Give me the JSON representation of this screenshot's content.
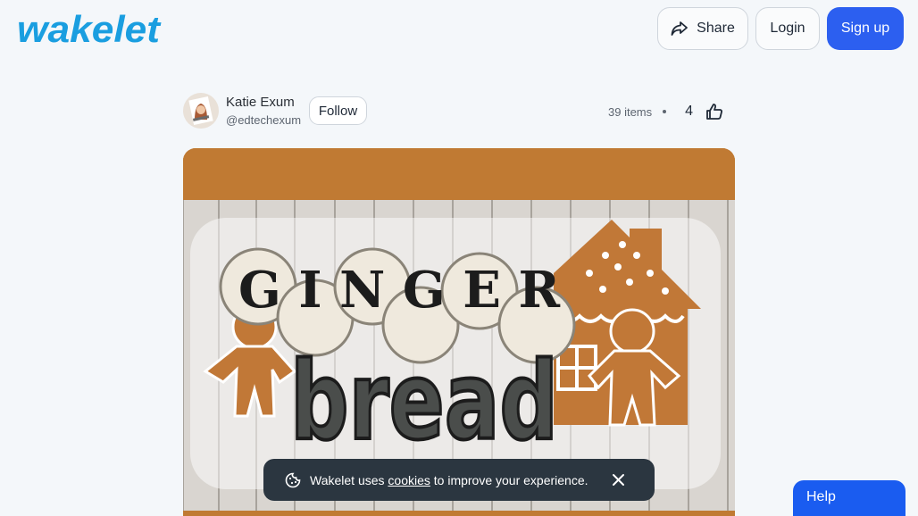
{
  "header": {
    "logo_text": "wakelet",
    "share_label": "Share",
    "login_label": "Login",
    "signup_label": "Sign up"
  },
  "profile": {
    "name": "Katie Exum",
    "handle": "@edtechexum",
    "follow_label": "Follow"
  },
  "stats": {
    "items": "39 items",
    "likes": "4"
  },
  "cover": {
    "title_top": "GINGER",
    "title_bottom": "bread",
    "colors": {
      "band": "#c07a33",
      "gingerbread": "#c17837"
    }
  },
  "cookie_banner": {
    "prefix": "Wakelet uses",
    "link": "cookies",
    "suffix": "to improve your experience."
  },
  "help": {
    "label": "Help"
  },
  "colors": {
    "brand": "#1a9ee0",
    "primary": "#2c5ff0",
    "dark": "#2b3640"
  }
}
